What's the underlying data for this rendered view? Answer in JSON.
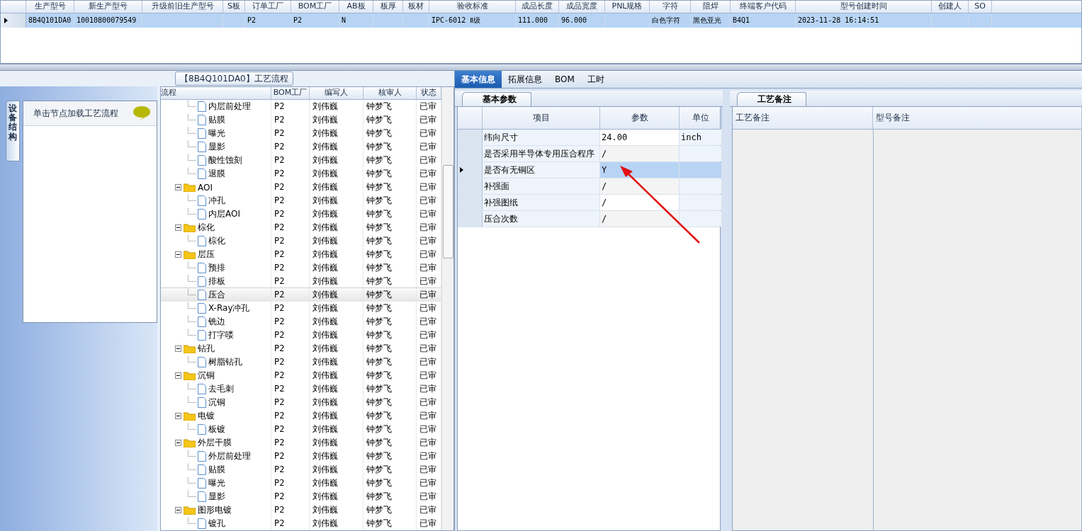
{
  "top_grid": {
    "columns": [
      "生产型号",
      "新生产型号",
      "升级前旧生产型号",
      "S板",
      "订单工厂",
      "BOM工厂",
      "AB板",
      "板厚",
      "板材",
      "验收标准",
      "成品长度",
      "成品宽度",
      "PNL规格",
      "字符",
      "阻焊",
      "终端客户代码",
      "型号创建时间",
      "创建人",
      "SO"
    ],
    "rows": [
      {
        "selected": true,
        "cells": {
          "c0": "8B4Q101DA0",
          "c1": "10010800079549",
          "c4": "P2",
          "c5": "P2",
          "c6": "N",
          "c9": "IPC-6012 Ⅱ级",
          "c10": "111.000",
          "c11": "96.000",
          "c13": "白色字符",
          "c14": "黑色亚光",
          "c15": "B4Q1",
          "c16": "2023-11-28 16:14:51"
        }
      }
    ]
  },
  "left_panel": {
    "tab": "设备结构",
    "hint": "单击节点加载工艺流程"
  },
  "process": {
    "title": "【8B4Q101DA0】工艺流程",
    "columns": [
      "流程",
      "BOM工厂",
      "编写人",
      "核审人",
      "状态"
    ],
    "nodes": [
      {
        "children": [
          {
            "label": "内层前处理",
            "factory": "P2",
            "writer": "刘伟巍",
            "reviewer": "钟梦飞",
            "status": "已审",
            "selected": false
          },
          {
            "label": "贴膜",
            "factory": "P2",
            "writer": "刘伟巍",
            "reviewer": "钟梦飞",
            "status": "已审",
            "selected": false
          },
          {
            "label": "曝光",
            "factory": "P2",
            "writer": "刘伟巍",
            "reviewer": "钟梦飞",
            "status": "已审",
            "selected": false
          },
          {
            "label": "显影",
            "factory": "P2",
            "writer": "刘伟巍",
            "reviewer": "钟梦飞",
            "status": "已审",
            "selected": false
          },
          {
            "label": "酸性蚀刻",
            "factory": "P2",
            "writer": "刘伟巍",
            "reviewer": "钟梦飞",
            "status": "已审",
            "selected": false
          },
          {
            "label": "退膜",
            "factory": "P2",
            "writer": "刘伟巍",
            "reviewer": "钟梦飞",
            "status": "已审",
            "selected": false
          }
        ]
      },
      {
        "label": "AOI",
        "factory": "P2",
        "writer": "刘伟巍",
        "reviewer": "钟梦飞",
        "status": "已审",
        "selected": false,
        "expanded": true,
        "children": [
          {
            "label": "冲孔",
            "factory": "P2",
            "writer": "刘伟巍",
            "reviewer": "钟梦飞",
            "status": "已审",
            "selected": false
          },
          {
            "label": "内层AOI",
            "factory": "P2",
            "writer": "刘伟巍",
            "reviewer": "钟梦飞",
            "status": "已审",
            "selected": false
          }
        ]
      },
      {
        "label": "棕化",
        "factory": "P2",
        "writer": "刘伟巍",
        "reviewer": "钟梦飞",
        "status": "已审",
        "selected": false,
        "expanded": true,
        "children": [
          {
            "label": "棕化",
            "factory": "P2",
            "writer": "刘伟巍",
            "reviewer": "钟梦飞",
            "status": "已审",
            "selected": false
          }
        ]
      },
      {
        "label": "层压",
        "factory": "P2",
        "writer": "刘伟巍",
        "reviewer": "钟梦飞",
        "status": "已审",
        "selected": false,
        "expanded": true,
        "children": [
          {
            "label": "预排",
            "factory": "P2",
            "writer": "刘伟巍",
            "reviewer": "钟梦飞",
            "status": "已审",
            "selected": false
          },
          {
            "label": "排板",
            "factory": "P2",
            "writer": "刘伟巍",
            "reviewer": "钟梦飞",
            "status": "已审",
            "selected": false
          },
          {
            "label": "压合",
            "factory": "P2",
            "writer": "刘伟巍",
            "reviewer": "钟梦飞",
            "status": "已审",
            "selected": true
          },
          {
            "label": "X-Ray冲孔",
            "factory": "P2",
            "writer": "刘伟巍",
            "reviewer": "钟梦飞",
            "status": "已审",
            "selected": false
          },
          {
            "label": "铣边",
            "factory": "P2",
            "writer": "刘伟巍",
            "reviewer": "钟梦飞",
            "status": "已审",
            "selected": false
          },
          {
            "label": "打字喽",
            "factory": "P2",
            "writer": "刘伟巍",
            "reviewer": "钟梦飞",
            "status": "已审",
            "selected": false
          }
        ]
      },
      {
        "label": "钻孔",
        "factory": "P2",
        "writer": "刘伟巍",
        "reviewer": "钟梦飞",
        "status": "已审",
        "selected": false,
        "expanded": true,
        "children": [
          {
            "label": "树脂钻孔",
            "factory": "P2",
            "writer": "刘伟巍",
            "reviewer": "钟梦飞",
            "status": "已审",
            "selected": false
          }
        ]
      },
      {
        "label": "沉铜",
        "factory": "P2",
        "writer": "刘伟巍",
        "reviewer": "钟梦飞",
        "status": "已审",
        "selected": false,
        "expanded": true,
        "children": [
          {
            "label": "去毛刺",
            "factory": "P2",
            "writer": "刘伟巍",
            "reviewer": "钟梦飞",
            "status": "已审",
            "selected": false
          },
          {
            "label": "沉铜",
            "factory": "P2",
            "writer": "刘伟巍",
            "reviewer": "钟梦飞",
            "status": "已审",
            "selected": false
          }
        ]
      },
      {
        "label": "电镀",
        "factory": "P2",
        "writer": "刘伟巍",
        "reviewer": "钟梦飞",
        "status": "已审",
        "selected": false,
        "expanded": true,
        "children": [
          {
            "label": "板镀",
            "factory": "P2",
            "writer": "刘伟巍",
            "reviewer": "钟梦飞",
            "status": "已审",
            "selected": false
          }
        ]
      },
      {
        "label": "外层干膜",
        "factory": "P2",
        "writer": "刘伟巍",
        "reviewer": "钟梦飞",
        "status": "已审",
        "selected": false,
        "expanded": true,
        "children": [
          {
            "label": "外层前处理",
            "factory": "P2",
            "writer": "刘伟巍",
            "reviewer": "钟梦飞",
            "status": "已审",
            "selected": false
          },
          {
            "label": "贴膜",
            "factory": "P2",
            "writer": "刘伟巍",
            "reviewer": "钟梦飞",
            "status": "已审",
            "selected": false
          },
          {
            "label": "曝光",
            "factory": "P2",
            "writer": "刘伟巍",
            "reviewer": "钟梦飞",
            "status": "已审",
            "selected": false
          },
          {
            "label": "显影",
            "factory": "P2",
            "writer": "刘伟巍",
            "reviewer": "钟梦飞",
            "status": "已审",
            "selected": false
          }
        ]
      },
      {
        "label": "图形电镀",
        "factory": "P2",
        "writer": "刘伟巍",
        "reviewer": "钟梦飞",
        "status": "已审",
        "selected": false,
        "expanded": true,
        "children": [
          {
            "label": "镀孔",
            "factory": "P2",
            "writer": "刘伟巍",
            "reviewer": "钟梦飞",
            "status": "已审",
            "selected": false
          }
        ]
      }
    ]
  },
  "tabs": [
    {
      "label": "基本信息",
      "selected": true
    },
    {
      "label": "拓展信息",
      "selected": false
    },
    {
      "label": "BOM",
      "selected": false
    },
    {
      "label": "工时",
      "selected": false
    }
  ],
  "params": {
    "tab": "基本参数",
    "columns": [
      "项目",
      "参数",
      "单位"
    ],
    "rows": [
      {
        "item": "纬向尺寸",
        "value": "24.00",
        "unit": "inch",
        "selected": false
      },
      {
        "item": "是否采用半导体专用压合程序",
        "value": "/",
        "selected": false
      },
      {
        "item": "是否有无铜区",
        "value": "Y",
        "selected": true
      },
      {
        "item": "补强面",
        "value": "/",
        "selected": false
      },
      {
        "item": "补强图纸",
        "value": "/",
        "selected": false
      },
      {
        "item": "压合次数",
        "value": "/",
        "selected": false
      }
    ]
  },
  "notes": {
    "tab": "工艺备注",
    "columns": [
      "工艺备注",
      "型号备注"
    ]
  }
}
